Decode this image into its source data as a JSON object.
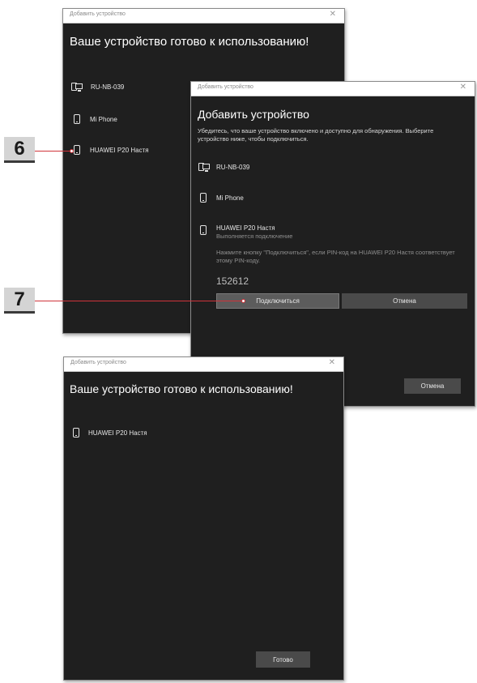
{
  "window1": {
    "title": "Добавить устройство",
    "close": "✕",
    "heading": "Ваше устройство готово к использованию!",
    "devices": [
      {
        "name": "RU-NB-039",
        "icon": "computer-icon"
      },
      {
        "name": "Mi Phone",
        "icon": "phone-icon"
      },
      {
        "name": "HUAWEI P20 Настя",
        "icon": "phone-icon"
      }
    ]
  },
  "window2": {
    "title": "Добавить устройство",
    "close": "✕",
    "heading": "Добавить устройство",
    "intro": "Убедитесь, что ваше устройство включено и доступно для обнаружения. Выберите устройство ниже, чтобы подключиться.",
    "devices": [
      {
        "name": "RU-NB-039",
        "icon": "computer-icon"
      },
      {
        "name": "Mi Phone",
        "icon": "phone-icon"
      },
      {
        "name": "HUAWEI P20 Настя",
        "icon": "phone-icon"
      }
    ],
    "connecting_status": "Выполняется подключение",
    "pin_hint": "Нажмите кнопку \"Подключиться\", если PIN-код на HUAWEI P20 Настя соответствует этому PIN-коду.",
    "pin_code": "152612",
    "connect_button": "Подключиться",
    "cancel_inline_button": "Отмена",
    "cancel_button": "Отмена"
  },
  "window3": {
    "title": "Добавить устройство",
    "close": "✕",
    "heading": "Ваше устройство готово к использованию!",
    "device": {
      "name": "HUAWEI P20 Настя",
      "icon": "phone-icon"
    },
    "done_button": "Готово"
  },
  "callouts": [
    {
      "label": "6"
    },
    {
      "label": "7"
    }
  ],
  "colors": {
    "window_bg": "#1f1f1f",
    "callout_line": "#d0333a",
    "badge_bg": "#d4d4d4"
  }
}
